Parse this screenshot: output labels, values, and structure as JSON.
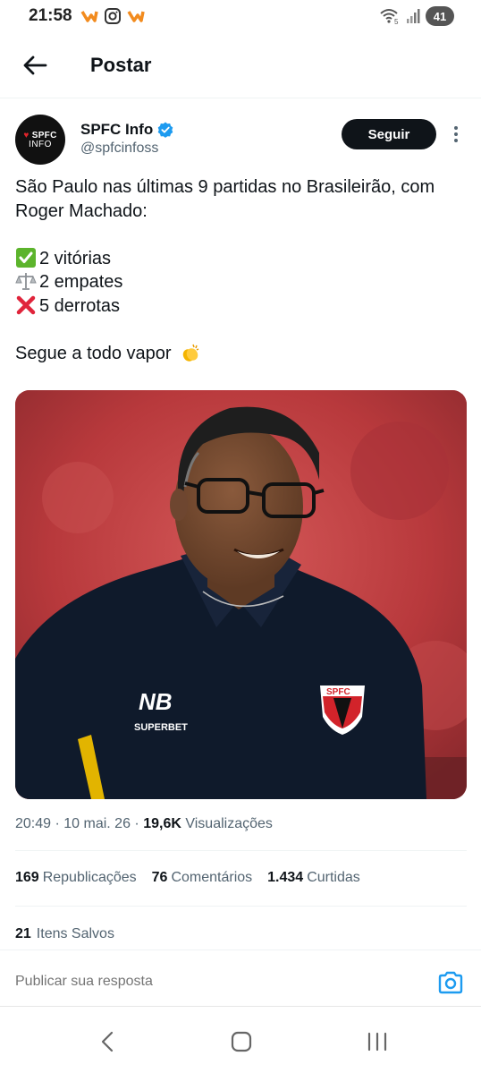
{
  "status_bar": {
    "time": "21:58",
    "battery": "41",
    "left_icons": [
      "app-notification-icon",
      "instagram-icon",
      "app-notification-icon"
    ],
    "right_icons": [
      "wifi-icon",
      "signal-icon",
      "battery-icon"
    ]
  },
  "header": {
    "title": "Postar",
    "back_icon": "arrow-left-icon"
  },
  "author": {
    "avatar_line1": "SPFC",
    "avatar_line2": "INFO",
    "name": "SPFC Info",
    "handle": "@spfcinfoss",
    "follow_label": "Seguir"
  },
  "tweet": {
    "line1": "São Paulo nas últimas 9 partidas no Brasileirão, com Roger Machado:",
    "stat1": "2 vitórias",
    "stat2": "2 empates",
    "stat3": "5 derrotas",
    "closing": "Segue a todo vapor"
  },
  "photo": {
    "shirt_brand": "SUPERBET",
    "badge": "SPFC"
  },
  "meta": {
    "time": "20:49",
    "date": "10 mai. 26",
    "views_count": "19,6K",
    "views_label": "Visualizações"
  },
  "stats": {
    "reposts_count": "169",
    "reposts_label": "Republicações",
    "comments_count": "76",
    "comments_label": "Comentários",
    "likes_count": "1.434",
    "likes_label": "Curtidas",
    "saved_count": "21",
    "saved_label": "Itens Salvos"
  },
  "reply": {
    "placeholder": "Publicar sua resposta"
  },
  "colors": {
    "accent": "#1d9bf0",
    "text_primary": "#0f1419",
    "text_secondary": "#536471",
    "follow_bg": "#0f1419"
  }
}
